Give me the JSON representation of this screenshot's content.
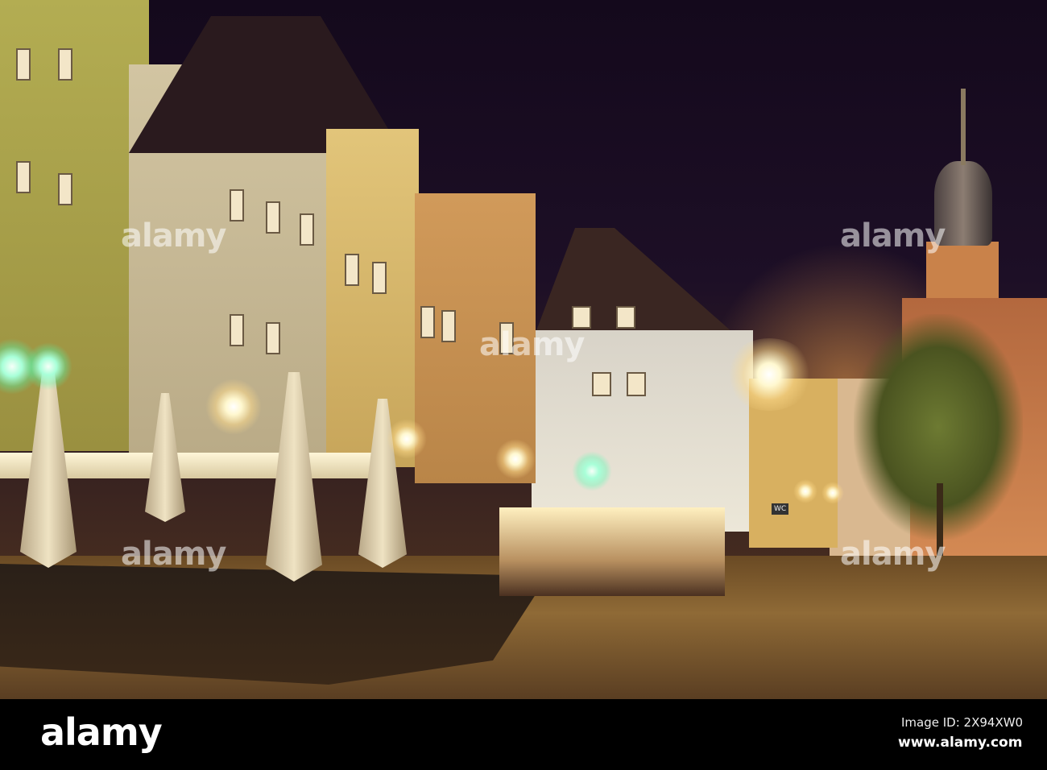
{
  "photo": {
    "subject": "Old Town Market Square at night with outdoor restaurant terraces",
    "signs": {
      "wc": "WC"
    }
  },
  "watermark": {
    "text": "alamy"
  },
  "banner": {
    "logo": "alamy",
    "image_id": "Image ID: 2X94XW0",
    "website": "www.alamy.com"
  }
}
